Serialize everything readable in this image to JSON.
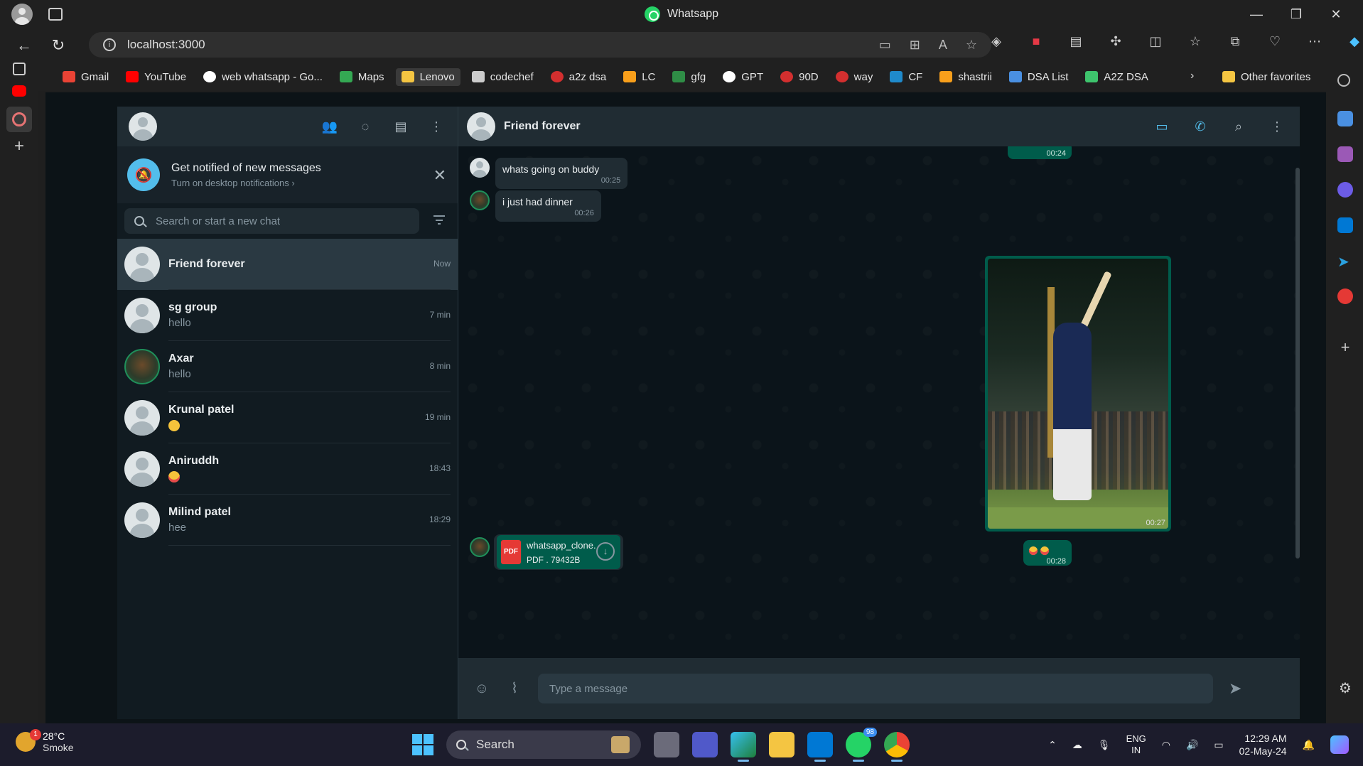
{
  "browser": {
    "window_title": "Whatsapp",
    "url": "localhost:3000",
    "bookmarks": [
      "Gmail",
      "YouTube",
      "web whatsapp - Go...",
      "Maps",
      "Lenovo",
      "codechef",
      "a2z dsa",
      "LC",
      "gfg",
      "GPT",
      "90D",
      "way",
      "CF",
      "shastrii",
      "DSA List",
      "A2Z DSA"
    ],
    "other_favorites": "Other favorites"
  },
  "sidebar": {
    "notification": {
      "title": "Get notified of new messages",
      "subtitle": "Turn on desktop notifications ›"
    },
    "search_placeholder": "Search or start a new chat",
    "chats": [
      {
        "name": "Friend forever",
        "last": "",
        "time": "Now"
      },
      {
        "name": "sg group",
        "last": "hello",
        "time": "7 min"
      },
      {
        "name": "Axar",
        "last": "hello",
        "time": "8 min"
      },
      {
        "name": "Krunal patel",
        "last": "",
        "time": "19 min"
      },
      {
        "name": "Aniruddh",
        "last": "",
        "time": "18:43"
      },
      {
        "name": "Milind patel",
        "last": "hee",
        "time": "18:29"
      }
    ]
  },
  "chat": {
    "contact_name": "Friend forever",
    "messages": [
      {
        "text": "whats going on buddy",
        "time": "00:25"
      },
      {
        "text": "i just had dinner",
        "time": "00:26"
      }
    ],
    "top_out_time": "00:24",
    "image_time": "00:27",
    "emoji_out_time": "00:28",
    "pdf": {
      "name": "whatsapp_clone.",
      "meta": "PDF . 79432B",
      "badge": "PDF"
    },
    "composer_placeholder": "Type a message"
  },
  "taskbar": {
    "weather_badge": "1",
    "temperature": "28°C",
    "condition": "Smoke",
    "search_label": "Search",
    "whatsapp_badge": "98",
    "lang_top": "ENG",
    "lang_bottom": "IN",
    "time": "12:29 AM",
    "date": "02-May-24"
  },
  "colors": {
    "accent": "#00a884",
    "outgoing_bubble": "#005c4b",
    "incoming_bubble": "#202c33",
    "panel_header": "#202c33",
    "sidebar_bg": "#111b21"
  }
}
